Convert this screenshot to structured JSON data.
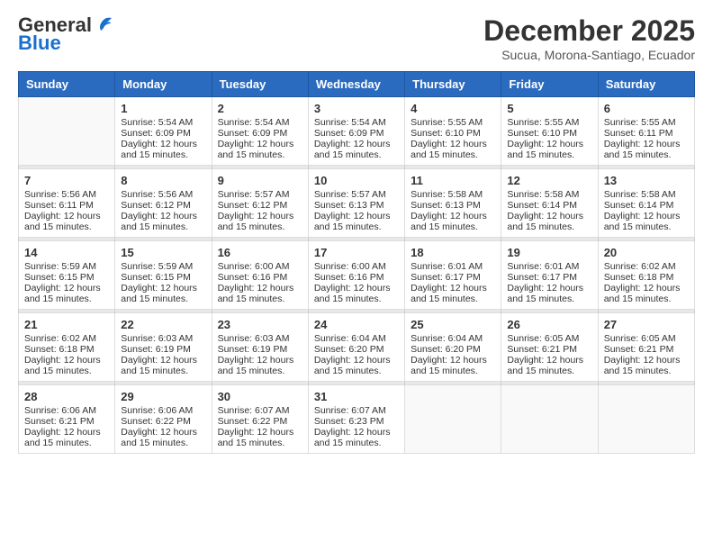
{
  "header": {
    "logo_general": "General",
    "logo_blue": "Blue",
    "month_title": "December 2025",
    "location": "Sucua, Morona-Santiago, Ecuador"
  },
  "weekdays": [
    "Sunday",
    "Monday",
    "Tuesday",
    "Wednesday",
    "Thursday",
    "Friday",
    "Saturday"
  ],
  "days": {
    "d1": {
      "num": "1",
      "sunrise": "5:54 AM",
      "sunset": "6:09 PM",
      "daylight": "12 hours and 15 minutes."
    },
    "d2": {
      "num": "2",
      "sunrise": "5:54 AM",
      "sunset": "6:09 PM",
      "daylight": "12 hours and 15 minutes."
    },
    "d3": {
      "num": "3",
      "sunrise": "5:54 AM",
      "sunset": "6:09 PM",
      "daylight": "12 hours and 15 minutes."
    },
    "d4": {
      "num": "4",
      "sunrise": "5:55 AM",
      "sunset": "6:10 PM",
      "daylight": "12 hours and 15 minutes."
    },
    "d5": {
      "num": "5",
      "sunrise": "5:55 AM",
      "sunset": "6:10 PM",
      "daylight": "12 hours and 15 minutes."
    },
    "d6": {
      "num": "6",
      "sunrise": "5:55 AM",
      "sunset": "6:11 PM",
      "daylight": "12 hours and 15 minutes."
    },
    "d7": {
      "num": "7",
      "sunrise": "5:56 AM",
      "sunset": "6:11 PM",
      "daylight": "12 hours and 15 minutes."
    },
    "d8": {
      "num": "8",
      "sunrise": "5:56 AM",
      "sunset": "6:12 PM",
      "daylight": "12 hours and 15 minutes."
    },
    "d9": {
      "num": "9",
      "sunrise": "5:57 AM",
      "sunset": "6:12 PM",
      "daylight": "12 hours and 15 minutes."
    },
    "d10": {
      "num": "10",
      "sunrise": "5:57 AM",
      "sunset": "6:13 PM",
      "daylight": "12 hours and 15 minutes."
    },
    "d11": {
      "num": "11",
      "sunrise": "5:58 AM",
      "sunset": "6:13 PM",
      "daylight": "12 hours and 15 minutes."
    },
    "d12": {
      "num": "12",
      "sunrise": "5:58 AM",
      "sunset": "6:14 PM",
      "daylight": "12 hours and 15 minutes."
    },
    "d13": {
      "num": "13",
      "sunrise": "5:58 AM",
      "sunset": "6:14 PM",
      "daylight": "12 hours and 15 minutes."
    },
    "d14": {
      "num": "14",
      "sunrise": "5:59 AM",
      "sunset": "6:15 PM",
      "daylight": "12 hours and 15 minutes."
    },
    "d15": {
      "num": "15",
      "sunrise": "5:59 AM",
      "sunset": "6:15 PM",
      "daylight": "12 hours and 15 minutes."
    },
    "d16": {
      "num": "16",
      "sunrise": "6:00 AM",
      "sunset": "6:16 PM",
      "daylight": "12 hours and 15 minutes."
    },
    "d17": {
      "num": "17",
      "sunrise": "6:00 AM",
      "sunset": "6:16 PM",
      "daylight": "12 hours and 15 minutes."
    },
    "d18": {
      "num": "18",
      "sunrise": "6:01 AM",
      "sunset": "6:17 PM",
      "daylight": "12 hours and 15 minutes."
    },
    "d19": {
      "num": "19",
      "sunrise": "6:01 AM",
      "sunset": "6:17 PM",
      "daylight": "12 hours and 15 minutes."
    },
    "d20": {
      "num": "20",
      "sunrise": "6:02 AM",
      "sunset": "6:18 PM",
      "daylight": "12 hours and 15 minutes."
    },
    "d21": {
      "num": "21",
      "sunrise": "6:02 AM",
      "sunset": "6:18 PM",
      "daylight": "12 hours and 15 minutes."
    },
    "d22": {
      "num": "22",
      "sunrise": "6:03 AM",
      "sunset": "6:19 PM",
      "daylight": "12 hours and 15 minutes."
    },
    "d23": {
      "num": "23",
      "sunrise": "6:03 AM",
      "sunset": "6:19 PM",
      "daylight": "12 hours and 15 minutes."
    },
    "d24": {
      "num": "24",
      "sunrise": "6:04 AM",
      "sunset": "6:20 PM",
      "daylight": "12 hours and 15 minutes."
    },
    "d25": {
      "num": "25",
      "sunrise": "6:04 AM",
      "sunset": "6:20 PM",
      "daylight": "12 hours and 15 minutes."
    },
    "d26": {
      "num": "26",
      "sunrise": "6:05 AM",
      "sunset": "6:21 PM",
      "daylight": "12 hours and 15 minutes."
    },
    "d27": {
      "num": "27",
      "sunrise": "6:05 AM",
      "sunset": "6:21 PM",
      "daylight": "12 hours and 15 minutes."
    },
    "d28": {
      "num": "28",
      "sunrise": "6:06 AM",
      "sunset": "6:21 PM",
      "daylight": "12 hours and 15 minutes."
    },
    "d29": {
      "num": "29",
      "sunrise": "6:06 AM",
      "sunset": "6:22 PM",
      "daylight": "12 hours and 15 minutes."
    },
    "d30": {
      "num": "30",
      "sunrise": "6:07 AM",
      "sunset": "6:22 PM",
      "daylight": "12 hours and 15 minutes."
    },
    "d31": {
      "num": "31",
      "sunrise": "6:07 AM",
      "sunset": "6:23 PM",
      "daylight": "12 hours and 15 minutes."
    }
  },
  "labels": {
    "sunrise": "Sunrise: ",
    "sunset": "Sunset: ",
    "daylight": "Daylight: "
  }
}
